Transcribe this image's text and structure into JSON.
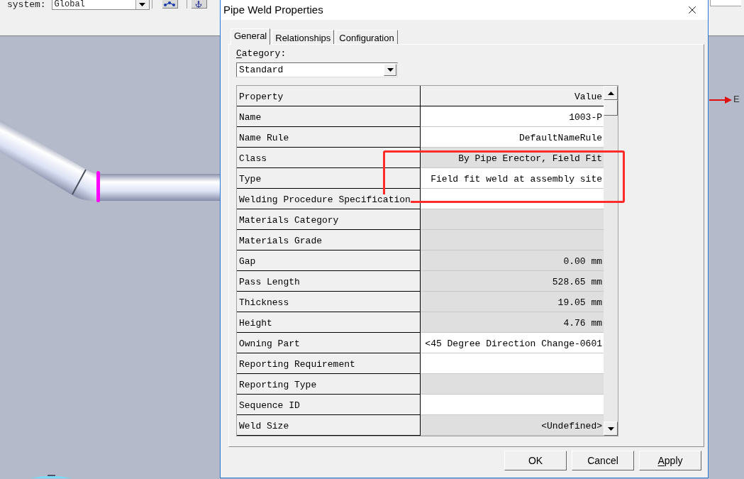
{
  "toolbar": {
    "system_label": "system:",
    "system_value": "Global"
  },
  "viewport": {
    "axis_label": "E"
  },
  "dialog": {
    "title": "Pipe Weld Properties",
    "tabs": [
      {
        "label": "General",
        "selected": true
      },
      {
        "label": "Relationships",
        "selected": false
      },
      {
        "label": "Configuration",
        "selected": false
      }
    ],
    "category": {
      "label": "Category:",
      "mnemonic_underlined": true,
      "value": "Standard"
    },
    "table": {
      "columns": [
        "Property",
        "Value"
      ],
      "rows": [
        {
          "property": "Name",
          "value": "1003-P",
          "editable": true
        },
        {
          "property": "Name Rule",
          "value": "DefaultNameRule",
          "editable": true
        },
        {
          "property": "Class",
          "value": "By Pipe Erector, Field Fit",
          "editable": false
        },
        {
          "property": "Type",
          "value": "Field fit weld at assembly site",
          "editable": true
        },
        {
          "property": "Welding Procedure Specification",
          "editable": true
        },
        {
          "property": "Materials Category",
          "editable": false
        },
        {
          "property": "Materials Grade",
          "editable": false
        },
        {
          "property": "Gap",
          "value": "0.00 mm",
          "editable": false
        },
        {
          "property": "Pass Length",
          "value": "528.65 mm",
          "editable": false
        },
        {
          "property": "Thickness",
          "value": "19.05 mm",
          "editable": false
        },
        {
          "property": "Height",
          "value": "4.76 mm",
          "editable": false
        },
        {
          "property": "Owning Part",
          "value": "<45 Degree Direction Change-0601",
          "editable": true
        },
        {
          "property": "Reporting Requirement",
          "editable": true
        },
        {
          "property": "Reporting Type",
          "editable": false
        },
        {
          "property": "Sequence ID",
          "editable": true
        },
        {
          "property": "Weld Size",
          "value": "<Undefined>",
          "editable": false
        }
      ]
    },
    "buttons": [
      {
        "label": "OK",
        "mnemonic_underlined": false
      },
      {
        "label": "Cancel",
        "mnemonic_underlined": false
      },
      {
        "label": "Apply",
        "mnemonic_underlined": true
      }
    ]
  },
  "annotation": {
    "kind": "rectangle"
  }
}
